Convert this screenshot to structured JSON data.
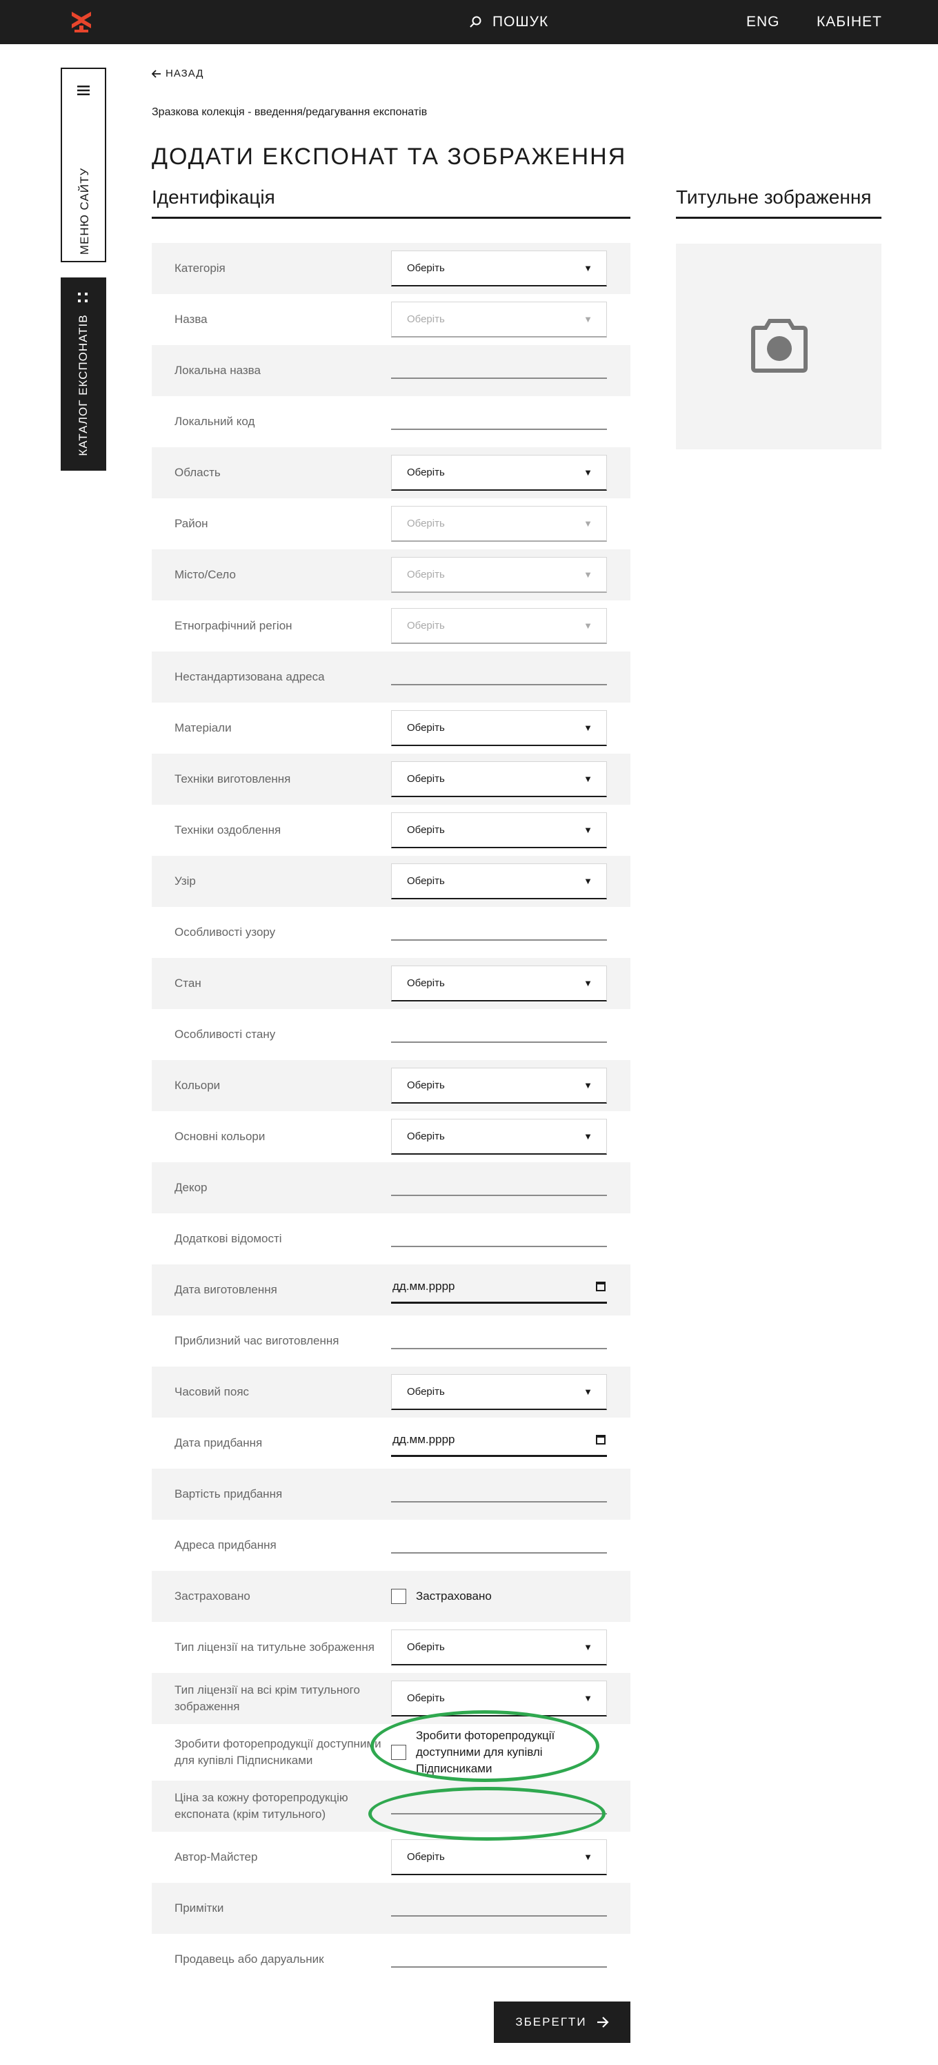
{
  "header": {
    "search": "ПОШУК",
    "lang": "ENG",
    "cabinet": "КАБІНЕТ"
  },
  "sidebar": {
    "menu": "МЕНЮ САЙТУ",
    "catalog": "КАТАЛОГ ЕКСПОНАТІВ"
  },
  "nav": {
    "back": "НАЗАД",
    "breadcrumb": "Зразкова колекція - введення/редагування експонатів"
  },
  "page": {
    "title": "ДОДАТИ ЕКСПОНАТ ТА ЗОБРАЖЕННЯ",
    "section": "Ідентифікація",
    "image_section": "Титульне зображення"
  },
  "form": {
    "rows": [
      {
        "label": "Категорія",
        "type": "select",
        "value": "Оберіть"
      },
      {
        "label": "Назва",
        "type": "select-disabled",
        "value": "Оберіть"
      },
      {
        "label": "Локальна назва",
        "type": "input"
      },
      {
        "label": "Локальний код",
        "type": "input"
      },
      {
        "label": "Область",
        "type": "select",
        "value": "Оберіть"
      },
      {
        "label": "Район",
        "type": "select-disabled",
        "value": "Оберіть"
      },
      {
        "label": "Місто/Село",
        "type": "select-disabled",
        "value": "Оберіть"
      },
      {
        "label": "Етнографічний регіон",
        "type": "select-disabled",
        "value": "Оберіть"
      },
      {
        "label": "Нестандартизована адреса",
        "type": "input"
      },
      {
        "label": "Матеріали",
        "type": "select",
        "value": "Оберіть"
      },
      {
        "label": "Техніки виготовлення",
        "type": "select",
        "value": "Оберіть"
      },
      {
        "label": "Техніки оздоблення",
        "type": "select",
        "value": "Оберіть"
      },
      {
        "label": "Узір",
        "type": "select",
        "value": "Оберіть"
      },
      {
        "label": "Особливості узору",
        "type": "input"
      },
      {
        "label": "Стан",
        "type": "select",
        "value": "Оберіть"
      },
      {
        "label": "Особливості стану",
        "type": "input"
      },
      {
        "label": "Кольори",
        "type": "select",
        "value": "Оберіть"
      },
      {
        "label": "Основні кольори",
        "type": "select",
        "value": "Оберіть"
      },
      {
        "label": "Декор",
        "type": "input"
      },
      {
        "label": "Додаткові відомості",
        "type": "input"
      },
      {
        "label": "Дата виготовлення",
        "type": "date",
        "value": "дд.мм.рррр"
      },
      {
        "label": "Приблизний час виготовлення",
        "type": "input"
      },
      {
        "label": "Часовий пояс",
        "type": "select",
        "value": "Оберіть"
      },
      {
        "label": "Дата придбання",
        "type": "date",
        "value": "дд.мм.рррр"
      },
      {
        "label": "Вартість придбання",
        "type": "input"
      },
      {
        "label": "Адреса придбання",
        "type": "input"
      },
      {
        "label": "Застраховано",
        "type": "checkbox",
        "value": "Застраховано"
      },
      {
        "label": "Тип ліцензії на титульне зображення",
        "type": "select",
        "value": "Оберіть"
      },
      {
        "label": "Тип ліцензії на всі крім титульного зображення",
        "type": "select",
        "value": "Оберіть"
      },
      {
        "label": "Зробити фоторепродукції доступними для купівлі Підписниками",
        "type": "checkbox",
        "value": "Зробити фоторепродукції доступними для купівлі Підписниками"
      },
      {
        "label": "Ціна за кожну фоторепродукцію експоната (крім титульного)",
        "type": "input"
      },
      {
        "label": "Автор-Майстер",
        "type": "select",
        "value": "Оберіть"
      },
      {
        "label": "Примітки",
        "type": "input"
      },
      {
        "label": "Продавець або даруальник",
        "type": "input"
      }
    ]
  },
  "actions": {
    "save": "ЗБЕРЕГТИ"
  },
  "colors": {
    "dark": "#1e1e1e",
    "accent": "#e8452c",
    "highlight": "#2fa84f",
    "row_shade": "#f3f3f3"
  }
}
